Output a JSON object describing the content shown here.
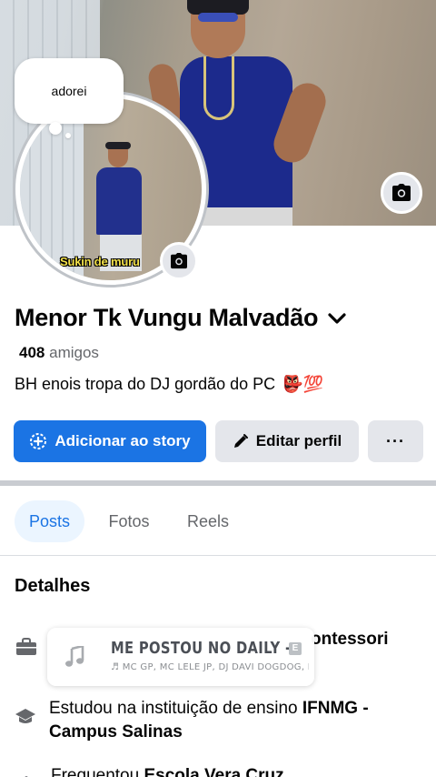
{
  "note": {
    "text": "adorei"
  },
  "profile": {
    "name": "Menor Tk Vungu Malvadão",
    "friends_count": "408",
    "friends_label": "amigos",
    "bio": "BH enois tropa do DJ gordão do PC",
    "bio_emoji": "👺💯",
    "avatar_caption": "Sukin de muru"
  },
  "actions": {
    "add_story": "Adicionar ao story",
    "edit_profile": "Editar perfil",
    "more": "···"
  },
  "tabs": [
    {
      "label": "Posts",
      "active": true
    },
    {
      "label": "Fotos",
      "active": false
    },
    {
      "label": "Reels",
      "active": false
    }
  ],
  "details": {
    "title": "Detalhes",
    "work_suffix": "ontessori",
    "study_prefix": "Estudou na instituição de ensino ",
    "study_place": "IFNMG - Campus Salinas",
    "attended_prefix": "Frequentou ",
    "attended_place": "Escola Vera Cruz"
  },
  "music": {
    "title": "ME POSTOU NO DAILY -",
    "artists": "♬ MC GP, MC LELE JP, DJ DAVI DOGDOG, DJ ANDRÉ"
  },
  "colors": {
    "primary": "#1b74e4",
    "button_gray": "#e4e6eb",
    "text_secondary": "#65676b",
    "active_tab_bg": "#ebf5ff"
  },
  "icons": [
    "camera-icon",
    "chevron-down-icon",
    "plus-circle-icon",
    "pencil-icon",
    "more-icon",
    "briefcase-icon",
    "graduation-cap-icon",
    "music-note-icon"
  ]
}
